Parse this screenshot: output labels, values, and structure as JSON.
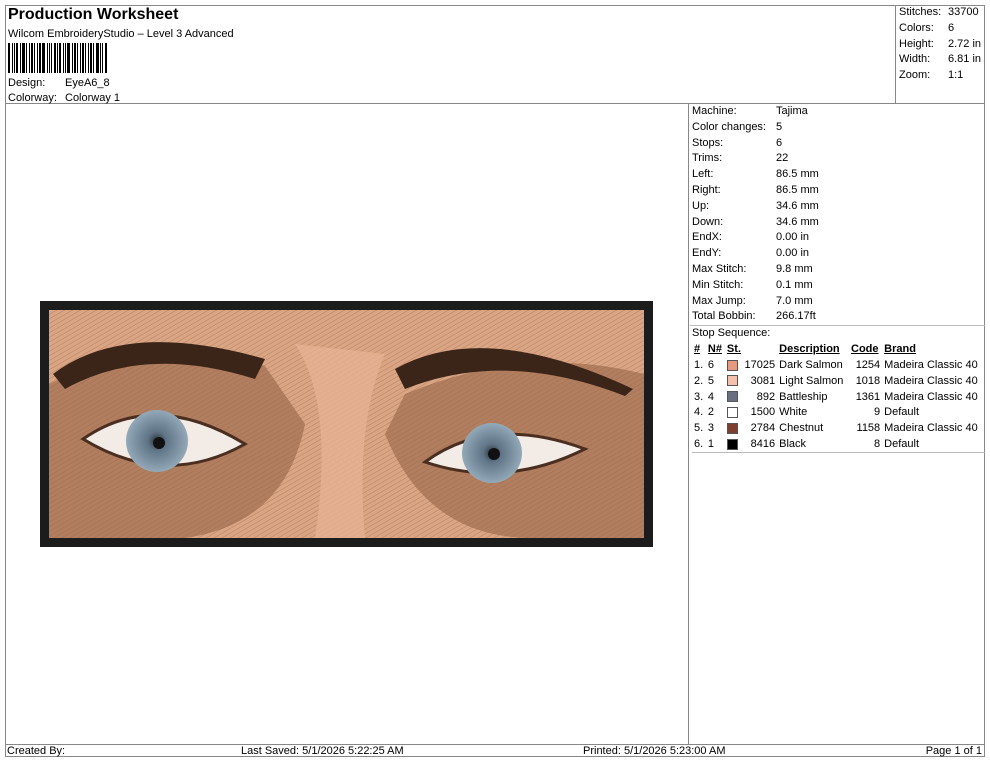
{
  "header": {
    "title": "Production Worksheet",
    "subtitle": "Wilcom EmbroideryStudio – Level 3 Advanced",
    "design_label": "Design:",
    "design_value": "EyeA6_8",
    "colorway_label": "Colorway:",
    "colorway_value": "Colorway 1"
  },
  "stats": {
    "stitches_label": "Stitches:",
    "stitches": "33700",
    "colors_label": "Colors:",
    "colors": "6",
    "height_label": "Height:",
    "height": "2.72 in",
    "width_label": "Width:",
    "width": "6.81 in",
    "zoom_label": "Zoom:",
    "zoom": "1:1"
  },
  "machine": {
    "machine_label": "Machine:",
    "machine": "Tajima",
    "color_changes_label": "Color changes:",
    "color_changes": "5",
    "stops_label": "Stops:",
    "stops": "6",
    "trims_label": "Trims:",
    "trims": "22",
    "left_label": "Left:",
    "left": "86.5 mm",
    "right_label": "Right:",
    "right": "86.5 mm",
    "up_label": "Up:",
    "up": "34.6 mm",
    "down_label": "Down:",
    "down": "34.6 mm",
    "endx_label": "EndX:",
    "endx": "0.00 in",
    "endy_label": "EndY:",
    "endy": "0.00 in",
    "max_stitch_label": "Max Stitch:",
    "max_stitch": "9.8 mm",
    "min_stitch_label": "Min Stitch:",
    "min_stitch": "0.1 mm",
    "max_jump_label": "Max Jump:",
    "max_jump": "7.0 mm",
    "total_bobbin_label": "Total Bobbin:",
    "total_bobbin": "266.17ft"
  },
  "stop_sequence": {
    "title": "Stop Sequence:",
    "headers": {
      "index": "#",
      "needle": "N#",
      "stitches": "St.",
      "description": "Description",
      "code": "Code",
      "brand": "Brand"
    },
    "rows": [
      {
        "index": "1.",
        "needle": "6",
        "color": "#e39a7e",
        "stitches": "17025",
        "description": "Dark Salmon",
        "code": "1254",
        "brand": "Madeira Classic 40"
      },
      {
        "index": "2.",
        "needle": "5",
        "color": "#f2c2ad",
        "stitches": "3081",
        "description": "Light Salmon",
        "code": "1018",
        "brand": "Madeira Classic 40"
      },
      {
        "index": "3.",
        "needle": "4",
        "color": "#6a7080",
        "stitches": "892",
        "description": "Battleship",
        "code": "1361",
        "brand": "Madeira Classic 40"
      },
      {
        "index": "4.",
        "needle": "2",
        "color": "#ffffff",
        "stitches": "1500",
        "description": "White",
        "code": "9",
        "brand": "Default"
      },
      {
        "index": "5.",
        "needle": "3",
        "color": "#7b4030",
        "stitches": "2784",
        "description": "Chestnut",
        "code": "1158",
        "brand": "Madeira Classic 40"
      },
      {
        "index": "6.",
        "needle": "1",
        "color": "#000000",
        "stitches": "8416",
        "description": "Black",
        "code": "8",
        "brand": "Default"
      }
    ]
  },
  "footer": {
    "created_by": "Created By:",
    "last_saved": "Last Saved: 5/1/2026 5:22:25 AM",
    "printed": "Printed: 5/1/2026 5:23:00 AM",
    "page": "Page 1 of 1"
  },
  "colors": {
    "frame": "#222222",
    "patch_bg": "#d9a584",
    "skin_dark": "#8a5a3e",
    "iris": "#7d95a8"
  }
}
